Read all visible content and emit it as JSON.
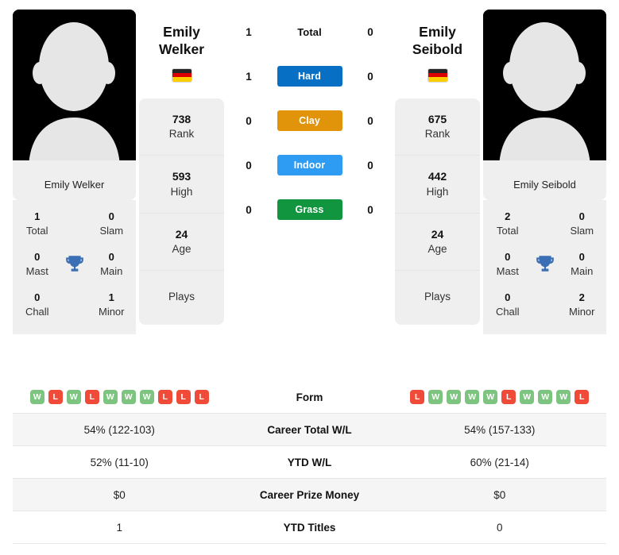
{
  "colors": {
    "hard": "#0770c4",
    "clay": "#e1940a",
    "indoor": "#2f9cf4",
    "grass": "#11953f",
    "win": "#7cc47f",
    "loss": "#ef4b38",
    "trophy": "#3b6fb5"
  },
  "players": {
    "left": {
      "name": "Emily Welker",
      "photo_caption": "Emily Welker",
      "country": "Germany",
      "titles": [
        {
          "value": "1",
          "label": "Total"
        },
        {
          "value": "0",
          "label": "Slam"
        },
        {
          "value": "0",
          "label": "Mast"
        },
        {
          "value": "0",
          "label": "Main"
        },
        {
          "value": "0",
          "label": "Chall"
        },
        {
          "value": "1",
          "label": "Minor"
        }
      ],
      "stats": [
        {
          "value": "738",
          "label": "Rank"
        },
        {
          "value": "593",
          "label": "High"
        },
        {
          "value": "24",
          "label": "Age"
        }
      ],
      "plays_label": "Plays",
      "plays_value": "",
      "form": [
        "W",
        "L",
        "W",
        "L",
        "W",
        "W",
        "W",
        "L",
        "L",
        "L"
      ],
      "career_total_wl": "54% (122-103)",
      "ytd_wl": "52% (11-10)",
      "career_prize_money": "$0",
      "ytd_titles": "1"
    },
    "right": {
      "name": "Emily Seibold",
      "photo_caption": "Emily Seibold",
      "country": "Germany",
      "titles": [
        {
          "value": "2",
          "label": "Total"
        },
        {
          "value": "0",
          "label": "Slam"
        },
        {
          "value": "0",
          "label": "Mast"
        },
        {
          "value": "0",
          "label": "Main"
        },
        {
          "value": "0",
          "label": "Chall"
        },
        {
          "value": "2",
          "label": "Minor"
        }
      ],
      "stats": [
        {
          "value": "675",
          "label": "Rank"
        },
        {
          "value": "442",
          "label": "High"
        },
        {
          "value": "24",
          "label": "Age"
        }
      ],
      "plays_label": "Plays",
      "plays_value": "",
      "form": [
        "L",
        "W",
        "W",
        "W",
        "W",
        "L",
        "W",
        "W",
        "W",
        "L"
      ],
      "career_total_wl": "54% (157-133)",
      "ytd_wl": "60% (21-14)",
      "career_prize_money": "$0",
      "ytd_titles": "0"
    }
  },
  "head_to_head": [
    {
      "surface": "Total",
      "left": "1",
      "right": "0"
    },
    {
      "surface": "Hard",
      "left": "1",
      "right": "0"
    },
    {
      "surface": "Clay",
      "left": "0",
      "right": "0"
    },
    {
      "surface": "Indoor",
      "left": "0",
      "right": "0"
    },
    {
      "surface": "Grass",
      "left": "0",
      "right": "0"
    }
  ],
  "table_labels": {
    "form": "Form",
    "career_total_wl": "Career Total W/L",
    "ytd_wl": "YTD W/L",
    "career_prize_money": "Career Prize Money",
    "ytd_titles": "YTD Titles"
  }
}
